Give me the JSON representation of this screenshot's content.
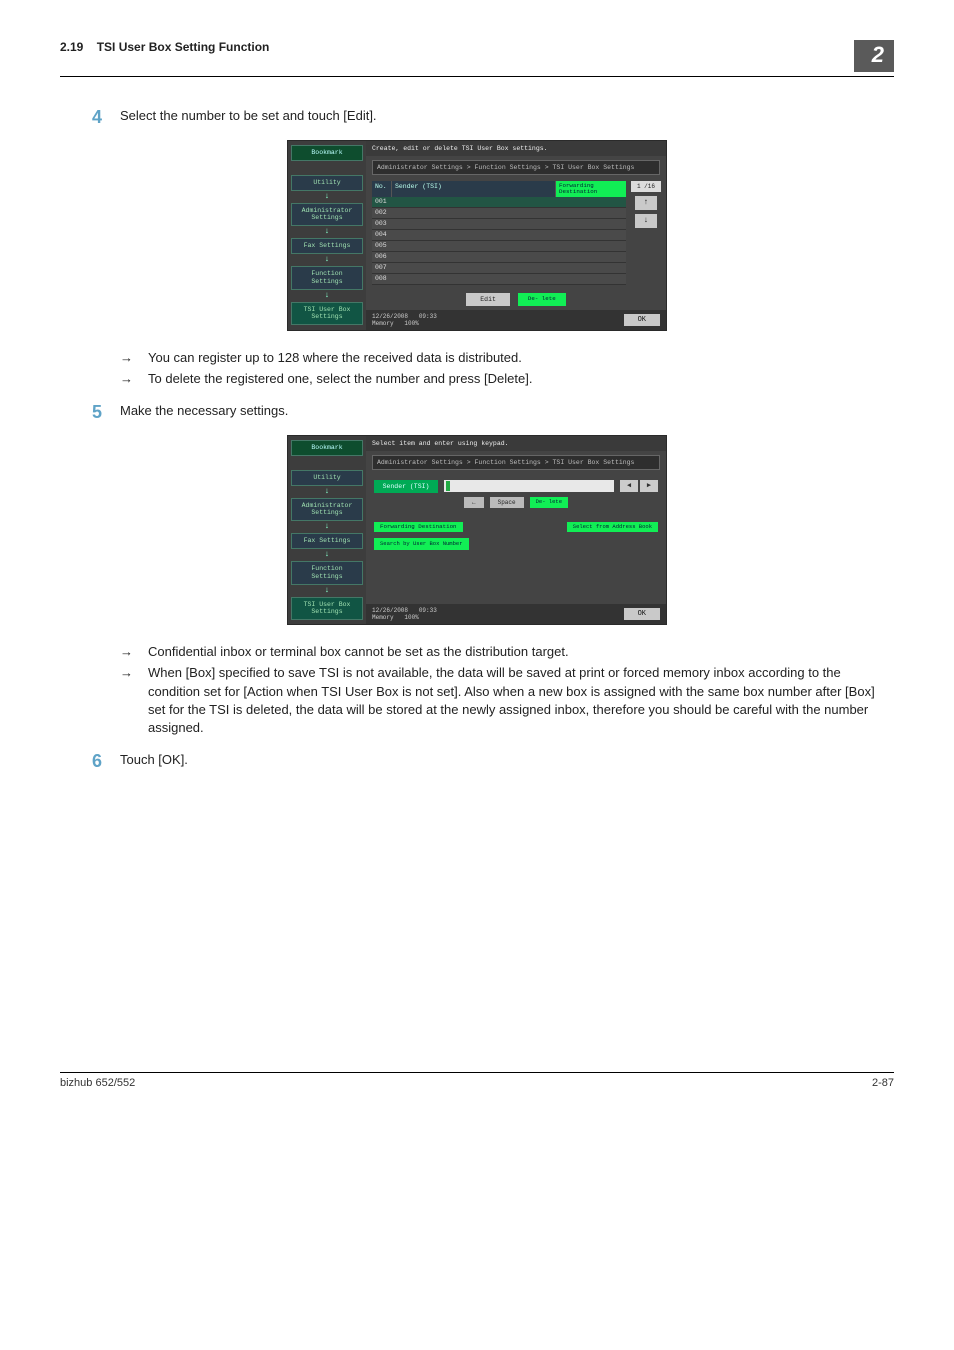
{
  "header": {
    "section_number": "2.19",
    "section_title": "TSI User Box Setting Function",
    "chapter_badge": "2"
  },
  "steps": {
    "s4": {
      "num": "4",
      "text": "Select the number to be set and touch [Edit]."
    },
    "s4_notes": [
      "You can register up to 128 where the received data is distributed.",
      "To delete the registered one, select the number and press [Delete]."
    ],
    "s5": {
      "num": "5",
      "text": "Make the necessary settings."
    },
    "s5_notes": [
      "Confidential inbox or terminal box cannot be set as the distribution target.",
      "When [Box] specified to save TSI is not available, the data will be saved at print or forced memory inbox according to the condition set for [Action when TSI User Box is not set]. Also when a new box is assigned with the same box number after [Box] set for the TSI is deleted, the data will be stored at the newly assigned inbox, therefore you should be careful with the number assigned."
    ],
    "s6": {
      "num": "6",
      "text": "Touch [OK]."
    }
  },
  "screen1": {
    "top_msg": "Create, edit or delete TSI User Box settings.",
    "breadcrumb": "Administrator Settings > Function Settings > TSI User Box Settings",
    "nav": {
      "bookmark": "Bookmark",
      "utility": "Utility",
      "admin": "Administrator Settings",
      "fax": "Fax Settings",
      "func": "Function Settings",
      "tsi": "TSI User Box Settings"
    },
    "table": {
      "headers": {
        "no": "No.",
        "sender": "Sender (TSI)",
        "fwd": "Forwarding Destination"
      },
      "rows": [
        "001",
        "002",
        "003",
        "004",
        "005",
        "006",
        "007",
        "008"
      ],
      "page_indicator": "1 /16"
    },
    "actions": {
      "edit": "Edit",
      "delete": "De- lete"
    },
    "status": {
      "date": "12/26/2008",
      "time": "09:33",
      "mem_label": "Memory",
      "mem_value": "100%",
      "ok": "OK"
    }
  },
  "screen2": {
    "top_msg": "Select item and enter using keypad.",
    "breadcrumb": "Administrator Settings > Function Settings > TSI User Box Settings",
    "nav": {
      "bookmark": "Bookmark",
      "utility": "Utility",
      "admin": "Administrator Settings",
      "fax": "Fax Settings",
      "func": "Function Settings",
      "tsi": "TSI User Box Settings"
    },
    "fields": {
      "sender_label": "Sender (TSI)",
      "key_back": "←",
      "key_space": "Space",
      "key_delete": "De- lete",
      "fwd_label": "Forwarding Destination",
      "select_book": "Select from Address Book",
      "search_box": "Search by User Box Number"
    },
    "status": {
      "date": "12/26/2008",
      "time": "09:33",
      "mem_label": "Memory",
      "mem_value": "100%",
      "ok": "OK"
    }
  },
  "footer": {
    "left": "bizhub 652/552",
    "right": "2-87"
  }
}
